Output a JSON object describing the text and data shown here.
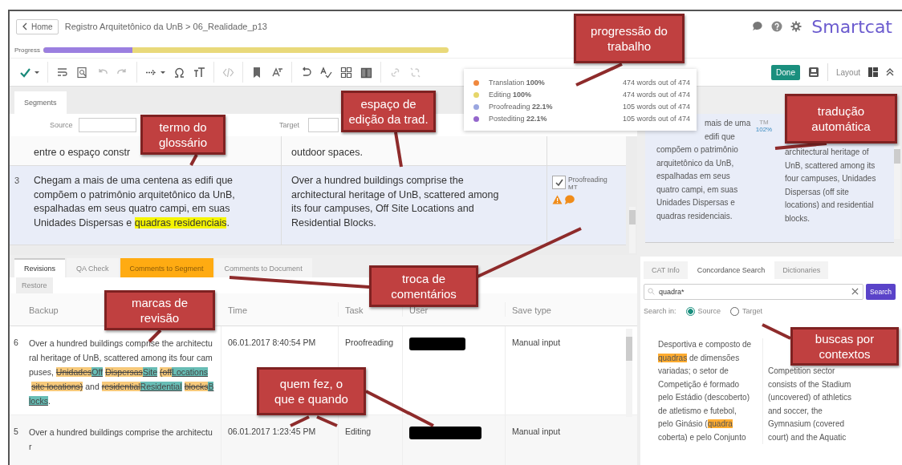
{
  "header": {
    "home": "Home",
    "breadcrumb": "Registro Arquitetônico da UnB > 06_Realidade_p13",
    "logo": "Smartcat"
  },
  "progress": {
    "label": "Progress",
    "level": 0.22
  },
  "toolbar_right": {
    "done": "Done",
    "layout": "Layout"
  },
  "progress_popup": [
    {
      "text": "Translation **100%**",
      "words": "474 words out of 474",
      "color": "#f0883e"
    },
    {
      "text": "Editing **100%**",
      "words": "474 words out of 474",
      "color": "#e6d66a"
    },
    {
      "text": "Proofreading **22.1%**",
      "words": "105 words out of 474",
      "color": "#9aa6e0"
    },
    {
      "text": "Postediting **22.1%**",
      "words": "105 words out of 474",
      "color": "#9466cc"
    }
  ],
  "segments_panel": {
    "tabs": [
      {
        "label": "Segments",
        "selected": true
      }
    ],
    "source_filter": "Source",
    "target_filter": "Target",
    "rows": [
      {
        "selected": false,
        "source": [
          {
            "text": "entre o espaço constr",
            "kind": "plain"
          }
        ],
        "target": "outdoor spaces."
      },
      {
        "selected": true,
        "number": "3",
        "source": [
          {
            "text": "Chegam a mais de uma centena as edifi que compõem o patrimônio arquitetônico da UnB, espalhadas em seus quatro campi, em suas Unidades Dispersas e ",
            "kind": "plain"
          },
          {
            "text": "quadras residenciais",
            "kind": "term"
          },
          {
            "text": ".",
            "kind": "plain"
          }
        ],
        "target": "Over a hundred buildings comprise the architectural heritage of UnB, scattered among its four campuses, Off Site Locations and Residential Blocks.",
        "status": {
          "checked": true,
          "label": "Proofreading",
          "sub": "MT"
        }
      }
    ]
  },
  "cat_panel": {
    "source_top": "mais de uma edifi que",
    "source": "compõem o patrimônio arquitetônico da UnB, espalhadas em seus quatro campi, em suas Unidades Dispersas e quadras residenciais.",
    "match_type": "TM",
    "match": "102%",
    "target": "architectural heritage of UnB, scattered among its four campuses, Unidades Dispersas (off site locations) and residential blocks."
  },
  "bottom_tabs": [
    {
      "label": "Revisions",
      "selected": true,
      "highlighted": false
    },
    {
      "label": "QA Check",
      "selected": false,
      "highlighted": false
    },
    {
      "label": "Comments to Segment",
      "selected": false,
      "highlighted": true
    },
    {
      "label": "Comments to Document",
      "selected": false,
      "highlighted": false
    }
  ],
  "restore": {
    "label": "Restore",
    "disabled": true
  },
  "revisions": {
    "columns": [
      "Backup",
      "Time",
      "Task",
      "User",
      "Save type"
    ],
    "rows": [
      {
        "number": "6",
        "backup": [
          {
            "text": "Over a hundred buildings comprise the architectural heritage of UnB, scattered among its four campuses, ",
            "kind": "plain"
          },
          {
            "text": "Unidades",
            "kind": "deleted"
          },
          {
            "text": "Off",
            "kind": "inserted"
          },
          {
            "text": "Dispersas",
            "kind": "deleted"
          },
          {
            "text": "Site",
            "kind": "inserted"
          },
          {
            "text": "(off",
            "kind": "deleted"
          },
          {
            "text": "Locations",
            "kind": "inserted"
          },
          {
            "text": "site locations)",
            "kind": "deleted"
          },
          {
            "text": " and ",
            "kind": "plain"
          },
          {
            "text": "residential",
            "kind": "deleted"
          },
          {
            "text": "Residential",
            "kind": "inserted"
          },
          {
            "text": "blocks",
            "kind": "deleted"
          },
          {
            "text": "Blocks",
            "kind": "inserted"
          },
          {
            "text": ".",
            "kind": "plain"
          }
        ],
        "time": "06.01.2017 8:40:54 PM",
        "task": "Proofreading",
        "save_type": "Manual input"
      },
      {
        "number": "5",
        "backup": [
          {
            "text": "Over a hundred buildings comprise the architectur",
            "kind": "plain"
          }
        ],
        "time": "06.01.2017 1:23:45 PM",
        "task": "Editing",
        "save_type": "Manual input"
      }
    ]
  },
  "cat_tabs": [
    {
      "label": "CAT Info",
      "selected": false
    },
    {
      "label": "Concordance Search",
      "selected": true
    },
    {
      "label": "Dictionaries",
      "selected": false
    }
  ],
  "concordance": {
    "query": "quadra*",
    "button": "Search",
    "search_in": "Search in:",
    "options": [
      {
        "label": "Source",
        "selected": true
      },
      {
        "label": "Target",
        "selected": false
      }
    ],
    "source_lines": [
      [
        {
          "text": "Desportiva e composto de",
          "highlight": false
        }
      ],
      [
        {
          "text": "quadras",
          "highlight": true
        },
        {
          "text": " de dimensões",
          "highlight": false
        }
      ],
      [
        {
          "text": "variadas; o setor de",
          "highlight": false
        }
      ],
      [
        {
          "text": "Competição é formado",
          "highlight": false
        }
      ],
      [
        {
          "text": "pelo Estádio (descoberto)",
          "highlight": false
        }
      ],
      [
        {
          "text": "de atletismo e futebol,",
          "highlight": false
        }
      ],
      [
        {
          "text": "pelo Ginásio (",
          "highlight": false
        },
        {
          "text": "quadra",
          "highlight": true
        }
      ],
      [
        {
          "text": "coberta) e pelo Conjunto",
          "highlight": false
        }
      ]
    ],
    "target_lines": [
      "Competition sector",
      "consists of the Stadium",
      "(uncovered) of athletics",
      "and soccer, the",
      "Gymnasium (covered",
      "court) and the Aquatic"
    ]
  },
  "callouts": [
    "progressão do trabalho",
    "espaço de edição da trad.",
    "termo do glossário",
    "tradução automática",
    "troca de comentários",
    "marcas de revisão",
    "quem fez, o que e quando",
    "buscas por contextos"
  ]
}
